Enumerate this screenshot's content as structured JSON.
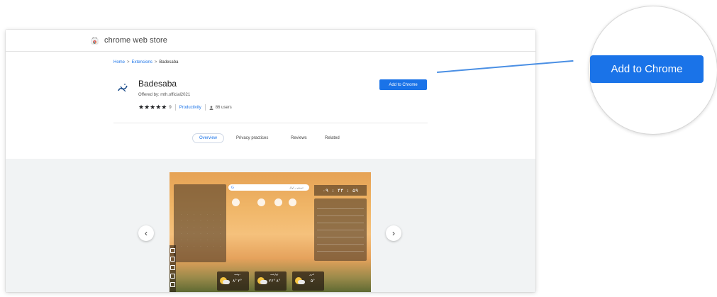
{
  "store": {
    "title": "chrome web store"
  },
  "breadcrumb": {
    "home": "Home",
    "extensions": "Extensions",
    "current": "Badesaba",
    "sep": ">"
  },
  "extension": {
    "name": "Badesaba",
    "offered_by": "Offered by: mth.official2021",
    "stars": "★★★★★",
    "rating_count": "9",
    "category": "Productivity",
    "users": "86 users"
  },
  "actions": {
    "add_small": "Add to Chrome",
    "add_big": "Add to Chrome"
  },
  "tabs": [
    "Overview",
    "Privacy practices",
    "Reviews",
    "Related"
  ],
  "gallery": {
    "prev": "‹",
    "next": "›"
  },
  "screenshot": {
    "clock": "۰۹ : ۴۴ : ۵۹",
    "search_placeholder": "جستجو در گوگل",
    "weather": [
      {
        "temp": "۸° ۲°",
        "day": "دوشنبه"
      },
      {
        "temp": "۲۶° ۸°",
        "day": "چهارشنبه"
      },
      {
        "temp": "۵°",
        "day": "امروز"
      }
    ]
  },
  "colors": {
    "accent": "#1a73e8",
    "connector": "#4a8fe4"
  }
}
